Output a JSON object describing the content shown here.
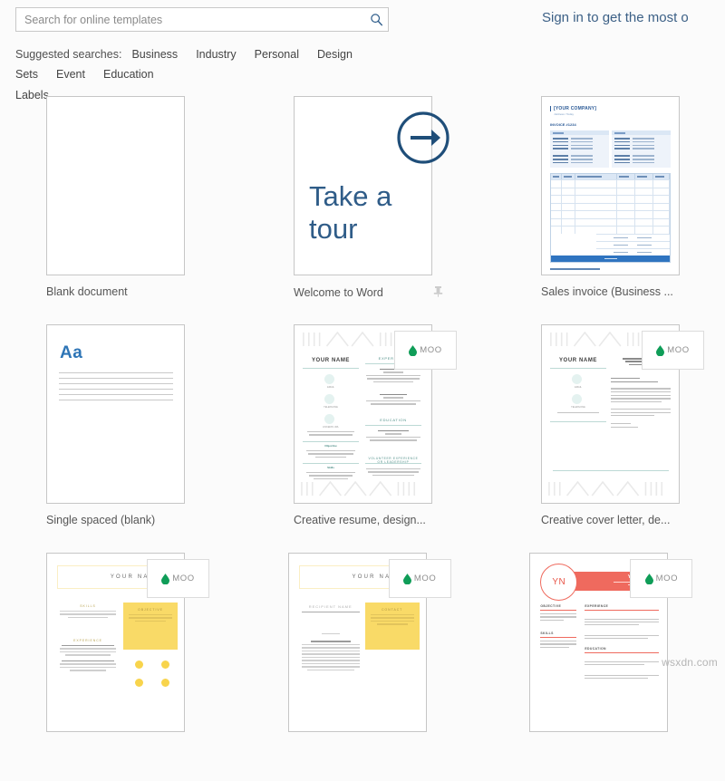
{
  "search": {
    "placeholder": "Search for online templates",
    "value": "",
    "icon": "search-icon"
  },
  "signin": {
    "label": "Sign in to get the most o"
  },
  "suggested": {
    "label": "Suggested searches:",
    "links": [
      "Business",
      "Industry",
      "Personal",
      "Design Sets",
      "Event",
      "Education",
      "Labels"
    ]
  },
  "templates": [
    {
      "name": "Blank document",
      "kind": "blank",
      "pinned": false,
      "pin_icon": ""
    },
    {
      "name": "Welcome to Word",
      "kind": "tour",
      "pinned": true,
      "pin_icon": "pin-icon",
      "tour_line1": "Take a",
      "tour_line2": "tour",
      "arrow_icon": "circle-arrow-right-icon",
      "accent": "#2f5c88"
    },
    {
      "name": "Sales invoice (Business ...",
      "kind": "invoice",
      "pinned": false,
      "pin_icon": "",
      "company": "[YOUR COMPANY]",
      "subtitle": "Address / Today",
      "title": "INVOICE #1234",
      "accent": "#2f74c0"
    },
    {
      "name": "Single spaced (blank)",
      "kind": "single-spaced",
      "pinned": false,
      "pin_icon": "",
      "sample_text": "Aa",
      "accent": "#2e75b6"
    },
    {
      "name": "Creative resume, design...",
      "kind": "creative-resume",
      "pinned": false,
      "pin_icon": "",
      "holder_name": "YOUR NAME",
      "badge": "MOO",
      "badge_icon": "moo-leaf-icon",
      "sections": [
        "EXPERIENCE",
        "EDUCATION",
        "VOLUNTEER EXPERIENCE OR LEADERSHIP"
      ],
      "left_sections": [
        "Objective",
        "Skills"
      ],
      "contact_labels": [
        "EMAIL",
        "TELEPHONE",
        "LINKEDIN URL"
      ],
      "accent": "#4f8f88"
    },
    {
      "name": "Creative cover letter, de...",
      "kind": "creative-cover-letter",
      "pinned": false,
      "pin_icon": "",
      "holder_name": "YOUR NAME",
      "badge": "MOO",
      "badge_icon": "moo-leaf-icon",
      "recipient": "RECIPIENT NAME / TITLE / COMPANY / ADDRESS",
      "contact_labels": [
        "EMAIL",
        "TELEPHONE"
      ],
      "accent": "#4f8f88"
    },
    {
      "name": "",
      "kind": "yellow-resume",
      "pinned": false,
      "pin_icon": "",
      "holder_name": "YOUR NAME",
      "badge": "MOO",
      "badge_icon": "moo-leaf-icon",
      "sections": [
        "SKILLS",
        "OBJECTIVE",
        "EXPERIENCE"
      ],
      "accent": "#f8d44c"
    },
    {
      "name": "",
      "kind": "yellow-cover-letter",
      "pinned": false,
      "pin_icon": "",
      "holder_name": "YOUR NAME",
      "badge": "MOO",
      "badge_icon": "moo-leaf-icon",
      "recipient": "RECIPIENT NAME",
      "sections": [
        "CONTACT"
      ],
      "accent": "#f8d44c"
    },
    {
      "name": "",
      "kind": "red-resume",
      "pinned": false,
      "pin_icon": "",
      "monogram": "YN",
      "holder_name": "YOUR NAME",
      "badge": "MOO",
      "badge_icon": "moo-leaf-icon",
      "sections": [
        "OBJECTIVE",
        "SKILLS",
        "EXPERIENCE",
        "EDUCATION"
      ],
      "accent": "#ef6a5e"
    }
  ],
  "watermark": "wsxdn.com"
}
